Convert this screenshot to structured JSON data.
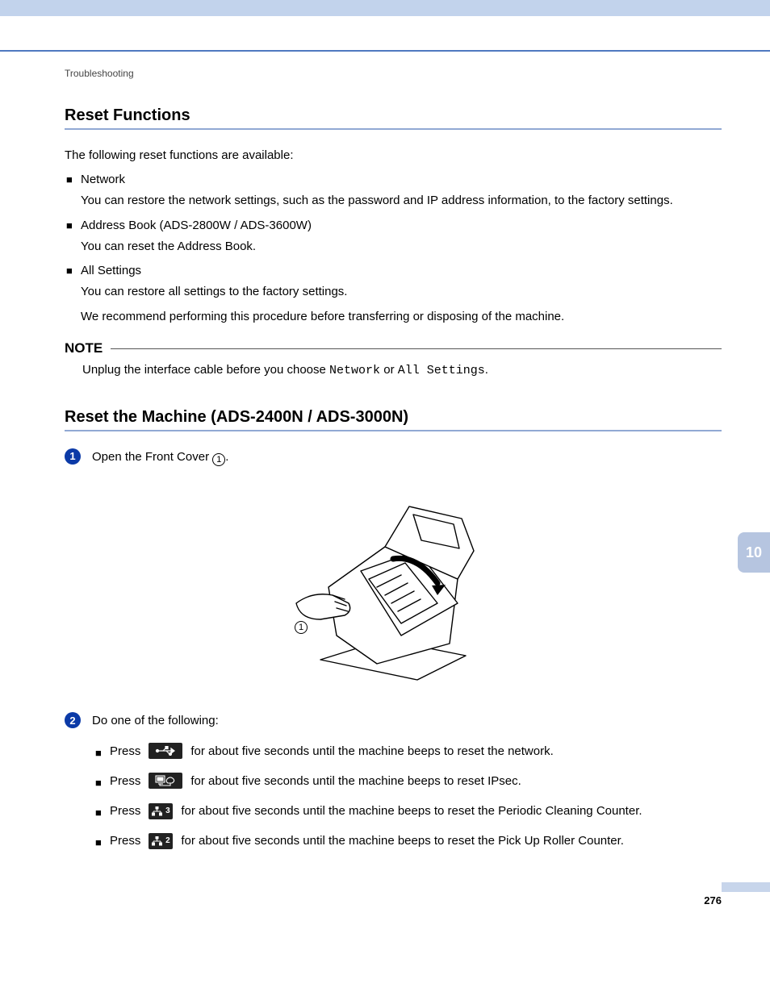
{
  "breadcrumb": "Troubleshooting",
  "h_reset_functions": "Reset Functions",
  "intro": "The following reset functions are available:",
  "bullets": [
    {
      "title": "Network",
      "body": [
        "You can restore the network settings, such as the password and IP address information, to the factory settings."
      ]
    },
    {
      "title": "Address Book (ADS-2800W / ADS-3600W)",
      "body": [
        "You can reset the Address Book."
      ]
    },
    {
      "title": "All Settings",
      "body": [
        "You can restore all settings to the factory settings.",
        "We recommend performing this procedure before transferring or disposing of the machine."
      ]
    }
  ],
  "note": {
    "label": "NOTE",
    "pre": "Unplug the interface cable before you choose ",
    "mono1": "Network",
    "mid": " or ",
    "mono2": "All Settings",
    "suf": "."
  },
  "h_reset_machine": "Reset the Machine (ADS-2400N / ADS-3000N)",
  "step1": {
    "n": "1",
    "pre": "Open the Front Cover ",
    "ref": "1",
    "suf": "."
  },
  "fig_ref": "1",
  "step2": {
    "n": "2",
    "text": "Do one of the following:"
  },
  "press_label": "Press",
  "press_items": [
    {
      "icon": "usb-icon",
      "text": " for about five seconds until the machine beeps to reset the network."
    },
    {
      "icon": "pc-icon",
      "text": " for about five seconds until the machine beeps to reset IPsec."
    },
    {
      "icon": "net-3-icon",
      "badge": "3",
      "text": " for about five seconds until the machine beeps to reset the Periodic Cleaning Counter."
    },
    {
      "icon": "net-2-icon",
      "badge": "2",
      "text": " for about five seconds until the machine beeps to reset the Pick Up Roller Counter."
    }
  ],
  "tab_number": "10",
  "page_number": "276"
}
